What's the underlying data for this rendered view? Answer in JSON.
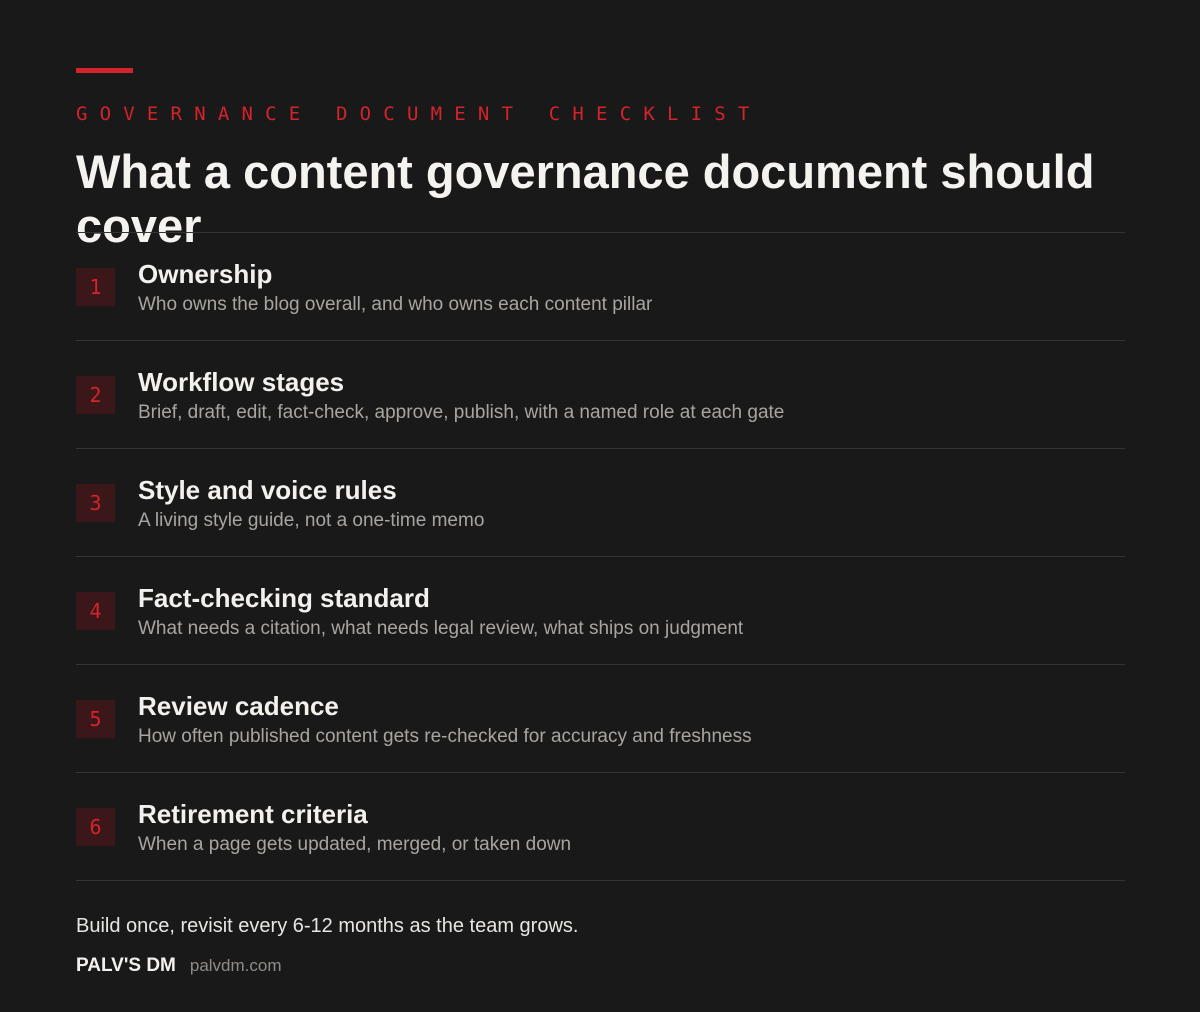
{
  "header": {
    "eyebrow": "GOVERNANCE DOCUMENT CHECKLIST",
    "title": "What a content governance document should cover"
  },
  "items": [
    {
      "number": "1",
      "title": "Ownership",
      "description": "Who owns the blog overall, and who owns each content pillar"
    },
    {
      "number": "2",
      "title": "Workflow stages",
      "description": "Brief, draft, edit, fact-check, approve, publish, with a named role at each gate"
    },
    {
      "number": "3",
      "title": "Style and voice rules",
      "description": "A living style guide, not a one-time memo"
    },
    {
      "number": "4",
      "title": "Fact-checking standard",
      "description": "What needs a citation, what needs legal review, what ships on judgment"
    },
    {
      "number": "5",
      "title": "Review cadence",
      "description": "How often published content gets re-checked for accuracy and freshness"
    },
    {
      "number": "6",
      "title": "Retirement criteria",
      "description": "When a page gets updated, merged, or taken down"
    }
  ],
  "footer": {
    "note": "Build once, revisit every 6-12 months as the team grows.",
    "brand_name": "PALV'S DM",
    "brand_url": "palvdm.com"
  },
  "colors": {
    "background": "#1a1919",
    "accent": "#d3232b",
    "badge_background": "#3b1719",
    "text_primary": "#f3f1ee",
    "text_secondary": "#a8a5a1",
    "divider": "#353434"
  }
}
